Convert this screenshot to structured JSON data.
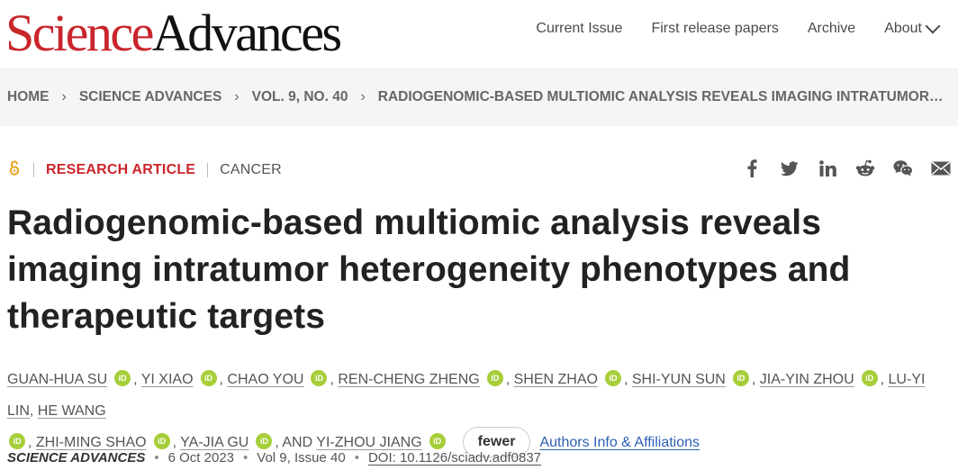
{
  "header": {
    "logo_part1": "Science",
    "logo_part2": "Advances",
    "nav": [
      "Current Issue",
      "First release papers",
      "Archive",
      "About"
    ]
  },
  "breadcrumb": [
    "HOME",
    "SCIENCE ADVANCES",
    "VOL. 9, NO. 40",
    "RADIOGENOMIC-BASED MULTIOMIC ANALYSIS REVEALS IMAGING INTRATUMOR…"
  ],
  "article": {
    "access_icon": "open-access-icon",
    "type": "RESEARCH ARTICLE",
    "subject": "CANCER",
    "title": "Radiogenomic-based multiomic analysis reveals imaging intratumor heterogeneity phenotypes and therapeutic targets",
    "share_icons": [
      "facebook-icon",
      "twitter-icon",
      "linkedin-icon",
      "reddit-icon",
      "wechat-icon",
      "email-icon"
    ]
  },
  "authors": {
    "names": [
      "GUAN-HUA SU",
      "YI XIAO",
      "CHAO YOU",
      "REN-CHENG ZHENG",
      "SHEN ZHAO",
      "SHI-YUN SUN",
      "JIA-YIN ZHOU",
      "LU-YI LIN",
      "HE WANG",
      "ZHI-MING SHAO",
      "YA-JIA GU",
      "YI-ZHOU JIANG"
    ],
    "and_label": "AND",
    "fewer_label": "fewer",
    "affiliations_label": "Authors Info & Affiliations",
    "orcid_label": "iD"
  },
  "citation": {
    "journal": "SCIENCE ADVANCES",
    "date": "6 Oct 2023",
    "volume": "Vol 9, Issue 40",
    "doi": "DOI: 10.1126/sciadv.adf0837"
  },
  "colors": {
    "brand_red": "#c9252c",
    "orcid_green": "#a6ce39",
    "link_blue": "#2c5fb3",
    "oa_orange": "#e8a21b"
  }
}
